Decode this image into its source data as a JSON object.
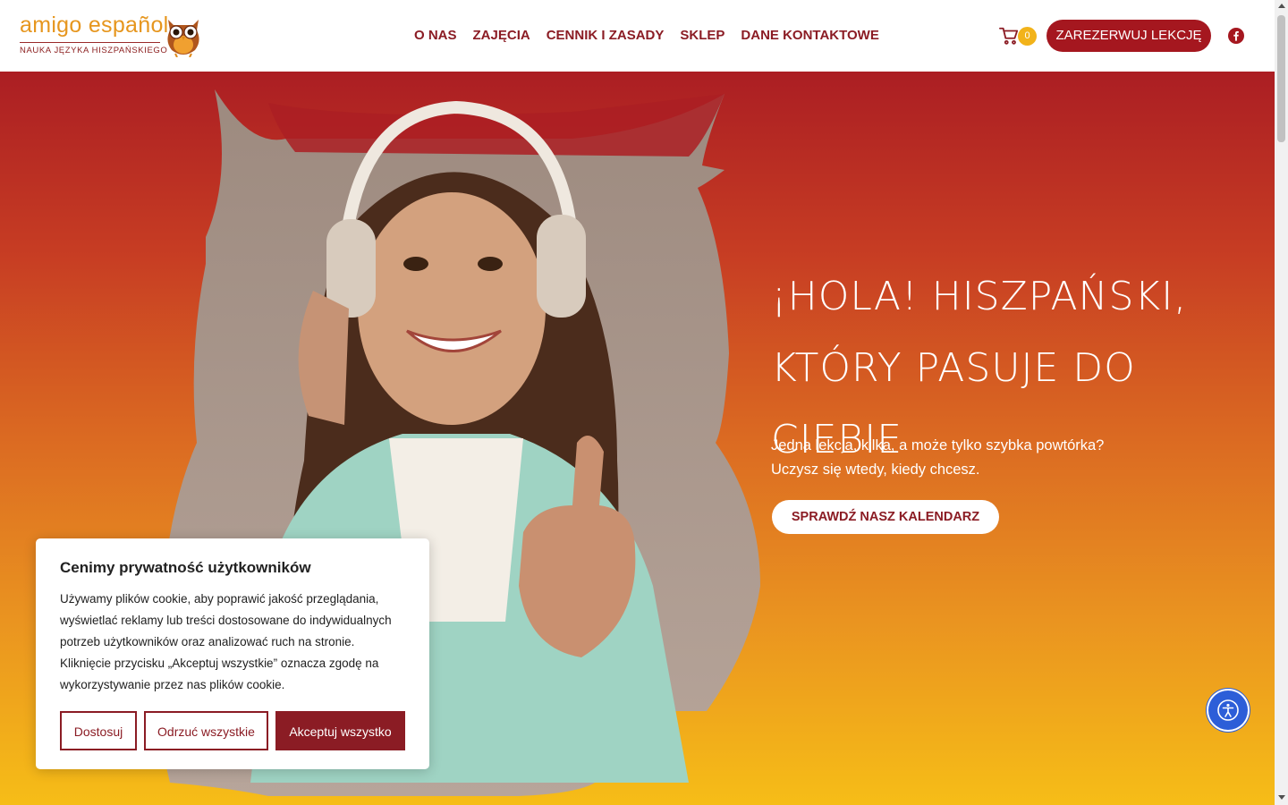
{
  "header": {
    "logo_text": "amigo español",
    "logo_subtitle": "NAUKA JĘZYKA HISZPAŃSKIEGO",
    "nav": [
      "O NAS",
      "ZAJĘCIA",
      "CENNIK I ZASADY",
      "SKLEP",
      "DANE KONTAKTOWE"
    ],
    "cart_count": "0",
    "book_button": "ZAREZERWUJ LEKCJĘ",
    "social_icon": "facebook-icon"
  },
  "hero": {
    "title_line1": "¡HOLA! HISZPAŃSKI,",
    "title_line2": "KTÓRY PASUJE DO CIEBIE",
    "subtitle_line1": "Jedna lekcja, kilka, a może tylko szybka powtórka?",
    "subtitle_line2": " Uczysz się wtedy, kiedy chcesz.",
    "cta": "SPRAWDŹ NASZ KALENDARZ"
  },
  "cookie": {
    "title": "Cenimy prywatność użytkowników",
    "text_lines": [
      "Używamy plików cookie, aby poprawić jakość przeglądania,",
      "wyświetlać reklamy lub treści dostosowane do indywidualnych",
      "potrzeb użytkowników oraz analizować ruch na stronie.",
      "Kliknięcie przycisku „Akceptuj wszystkie” oznacza zgodę na",
      "wykorzystywanie przez nas plików cookie."
    ],
    "btn_customize": "Dostosuj",
    "btn_reject": "Odrzuć wszystkie",
    "btn_accept": "Akceptuj wszystko"
  },
  "colors": {
    "brand_dark_red": "#8b1c24",
    "button_red": "#a5171f",
    "gradient_top": "#ab1e23",
    "gradient_bottom": "#f6bd17",
    "badge_yellow": "#f2b31a",
    "accessibility_blue": "#2c5ed8"
  }
}
